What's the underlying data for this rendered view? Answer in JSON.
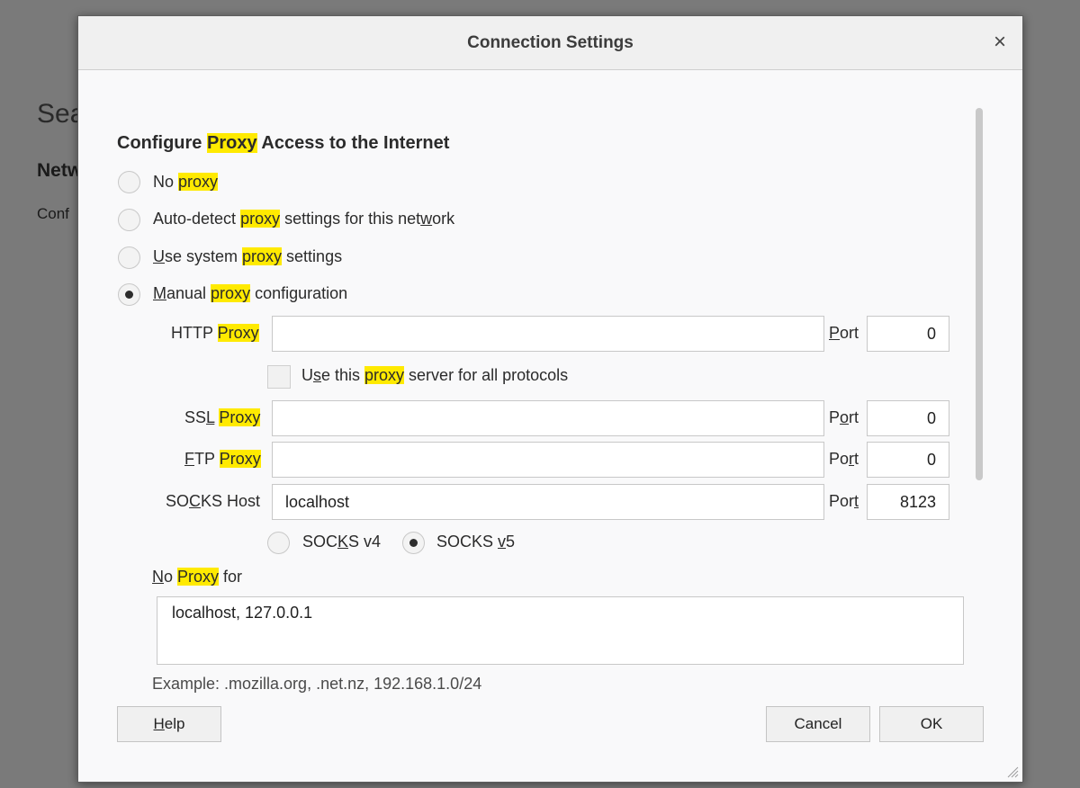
{
  "background": {
    "heading": "Sea",
    "subheading": "Netw",
    "text": "Conf"
  },
  "dialog": {
    "title": "Connection Settings",
    "close_glyph": "×",
    "section_heading": {
      "pre": "Configure ",
      "hl": "Proxy",
      "post": " Access to the Internet"
    },
    "options": {
      "no_proxy": {
        "pre": "No ",
        "hl": "proxy",
        "post": ""
      },
      "auto_detect": {
        "pre": "Auto-detect ",
        "hl": "proxy",
        "mid": " settings for this net",
        "acc": "w",
        "post": "ork"
      },
      "system": {
        "acc": "U",
        "pre": "se system ",
        "hl": "proxy",
        "post": " settings"
      },
      "manual": {
        "acc": "M",
        "pre": "anual ",
        "hl": "proxy",
        "post": " configuration"
      }
    },
    "selected_option": "manual",
    "http": {
      "label_pre": "HTTP ",
      "label_hl": "Proxy",
      "value": "",
      "port_acc": "P",
      "port_rest": "ort",
      "port_value": "0"
    },
    "use_for_all": {
      "pre": "U",
      "acc": "s",
      "mid": "e this ",
      "hl": "proxy",
      "post": " server for all protocols",
      "checked": false
    },
    "ssl": {
      "label_pre": "SS",
      "label_acc": "L",
      "label_sp": " ",
      "label_hl": "Proxy",
      "value": "",
      "port_pre": "P",
      "port_acc": "o",
      "port_rest": "rt",
      "port_value": "0"
    },
    "ftp": {
      "label_acc": "F",
      "label_pre": "TP ",
      "label_hl": "Proxy",
      "value": "",
      "port_pre": "Po",
      "port_acc": "r",
      "port_rest": "t",
      "port_value": "0"
    },
    "socks": {
      "label_pre": "SO",
      "label_acc": "C",
      "label_post": "KS Host",
      "value": "localhost",
      "port_pre": "Por",
      "port_acc": "t",
      "port_value": "8123"
    },
    "socks_v4": {
      "pre": "SOC",
      "acc": "K",
      "post": "S v4"
    },
    "socks_v5": {
      "pre": "SOCKS ",
      "acc": "v",
      "post": "5"
    },
    "socks_version": "v5",
    "no_proxy_for": {
      "acc": "N",
      "pre": "o ",
      "hl": "Proxy",
      "post": " for",
      "value": "localhost, 127.0.0.1"
    },
    "example": "Example: .mozilla.org, .net.nz, 192.168.1.0/24",
    "buttons": {
      "help_acc": "H",
      "help_rest": "elp",
      "cancel": "Cancel",
      "ok": "OK"
    }
  }
}
